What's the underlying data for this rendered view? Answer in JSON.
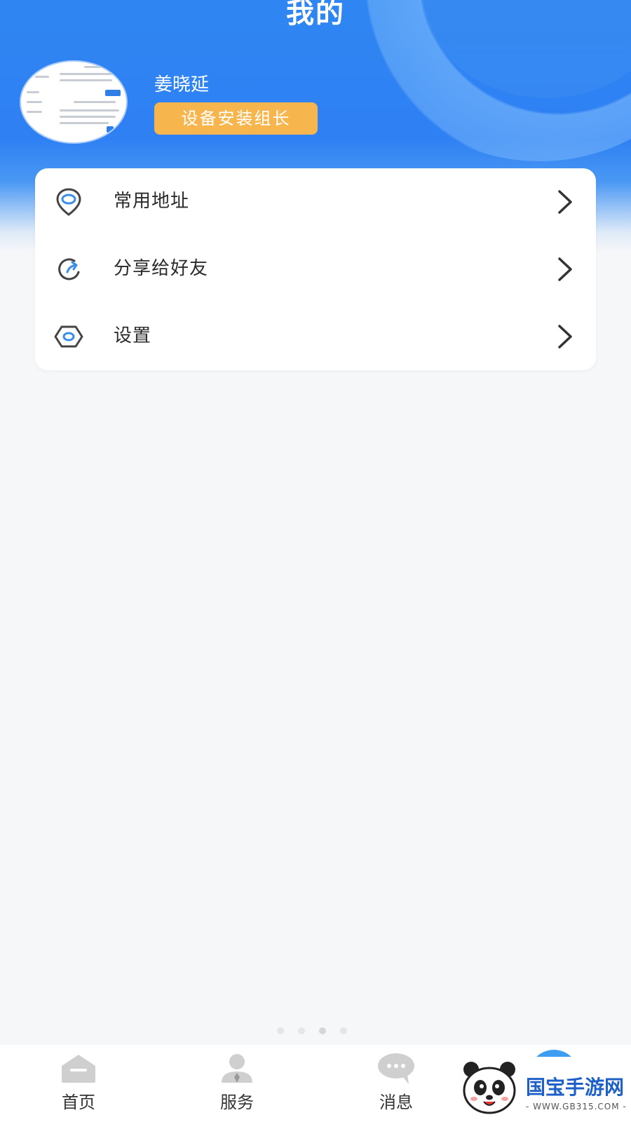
{
  "header": {
    "title": "我的",
    "user_name": "姜晓延",
    "role": "设备安装组长"
  },
  "menu": {
    "items": [
      {
        "label": "常用地址",
        "icon": "location-pin-icon"
      },
      {
        "label": "分享给好友",
        "icon": "share-refresh-icon"
      },
      {
        "label": "设置",
        "icon": "settings-hexagon-icon"
      }
    ]
  },
  "tabbar": {
    "items": [
      {
        "label": "首页",
        "icon": "home-icon"
      },
      {
        "label": "服务",
        "icon": "service-person-icon"
      },
      {
        "label": "消息",
        "icon": "message-bubble-icon"
      }
    ]
  },
  "watermark": {
    "text": "国宝手游网",
    "url": "- WWW.GB315.COM -"
  },
  "colors": {
    "header_blue": "#2f80f3",
    "badge_orange": "#f7b54d",
    "icon_blue": "#3a8ee8",
    "background": "#f6f7f9"
  }
}
